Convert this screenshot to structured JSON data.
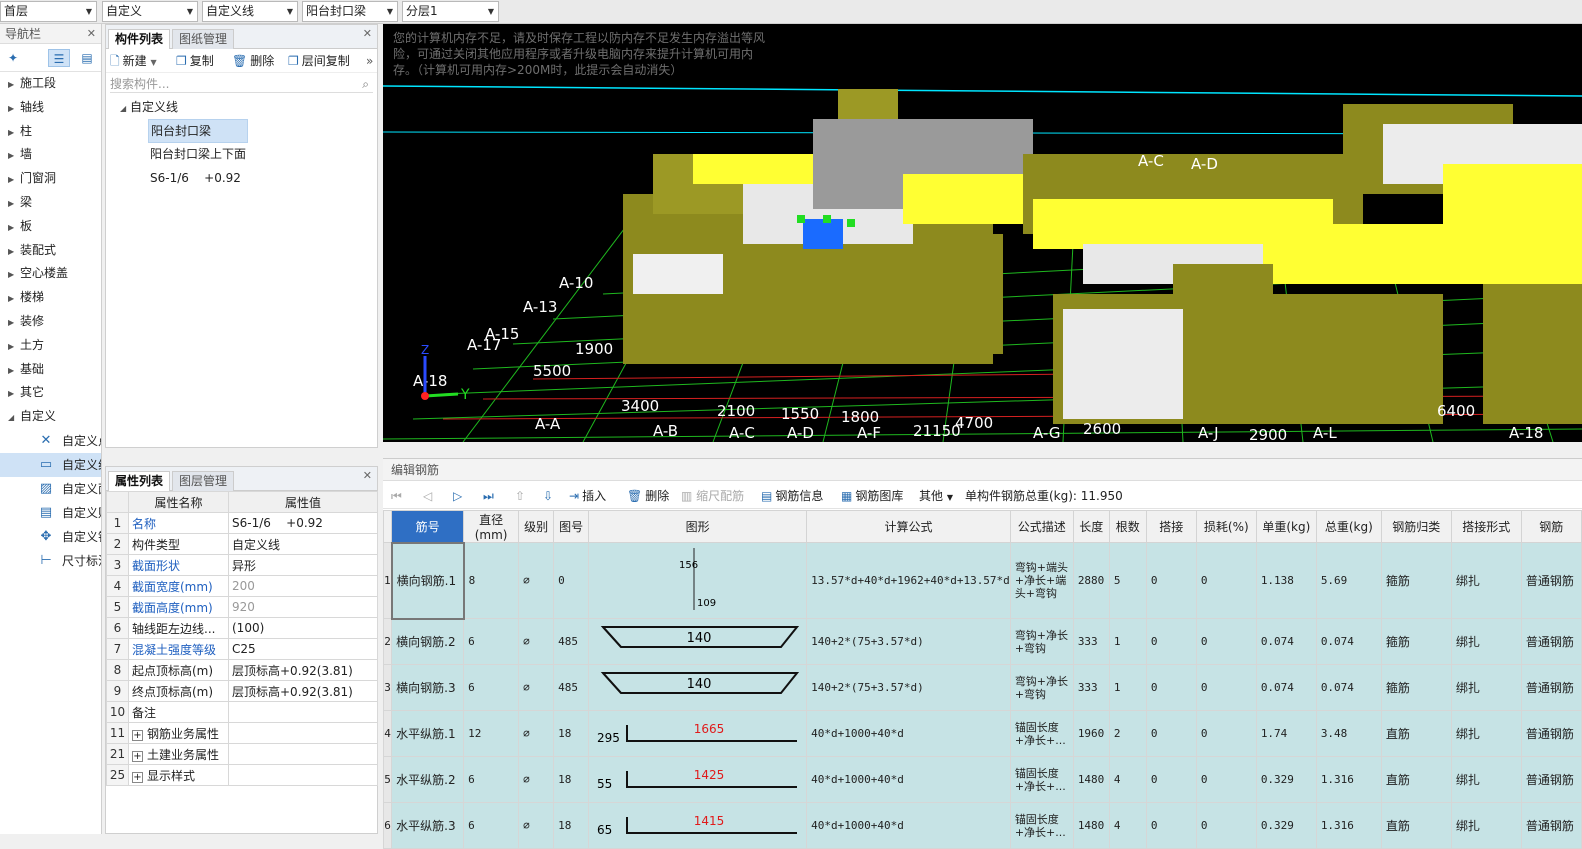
{
  "topbar": {
    "floor": "首层",
    "category": "自定义",
    "type": "自定义线",
    "component": "阳台封口梁",
    "layer": "分层1"
  },
  "nav": {
    "title": "导航栏",
    "items": [
      "施工段",
      "轴线",
      "柱",
      "墙",
      "门窗洞",
      "梁",
      "板",
      "装配式",
      "空心楼盖",
      "楼梯",
      "装修",
      "土方",
      "基础",
      "其它",
      "自定义"
    ],
    "subitems": [
      "自定义点",
      "自定义线",
      "自定义面",
      "自定义贴面",
      "自定义钢筋",
      "尺寸标注"
    ]
  },
  "complist": {
    "tab_active": "构件列表",
    "tab_other": "图纸管理",
    "tools": {
      "new": "新建",
      "copy": "复制",
      "delete": "删除",
      "floor_copy": "层间复制"
    },
    "search_placeholder": "搜索构件...",
    "tree_root": "自定义线",
    "items": [
      "阳台封口梁",
      "阳台封口梁上下面",
      "S6-1/6    +0.92"
    ]
  },
  "props": {
    "tab_active": "属性列表",
    "tab_other": "图层管理",
    "col_name": "属性名称",
    "col_value": "属性值",
    "rows": [
      {
        "n": "1",
        "k": "名称",
        "v": "S6-1/6    +0.92",
        "kc": "blue",
        "vc": ""
      },
      {
        "n": "2",
        "k": "构件类型",
        "v": "自定义线",
        "kc": "",
        "vc": ""
      },
      {
        "n": "3",
        "k": "截面形状",
        "v": "异形",
        "kc": "blue",
        "vc": ""
      },
      {
        "n": "4",
        "k": "截面宽度(mm)",
        "v": "200",
        "kc": "blue",
        "vc": "grey"
      },
      {
        "n": "5",
        "k": "截面高度(mm)",
        "v": "920",
        "kc": "blue",
        "vc": "grey"
      },
      {
        "n": "6",
        "k": "轴线距左边线...",
        "v": "(100)",
        "kc": "",
        "vc": ""
      },
      {
        "n": "7",
        "k": "混凝土强度等级",
        "v": "C25",
        "kc": "blue",
        "vc": ""
      },
      {
        "n": "8",
        "k": "起点顶标高(m)",
        "v": "层顶标高+0.92(3.81)",
        "kc": "",
        "vc": ""
      },
      {
        "n": "9",
        "k": "终点顶标高(m)",
        "v": "层顶标高+0.92(3.81)",
        "kc": "",
        "vc": ""
      },
      {
        "n": "10",
        "k": "备注",
        "v": "",
        "kc": "",
        "vc": ""
      },
      {
        "n": "11",
        "k": "钢筋业务属性",
        "v": "",
        "kc": "",
        "vc": "",
        "g": true
      },
      {
        "n": "21",
        "k": "土建业务属性",
        "v": "",
        "kc": "",
        "vc": "",
        "g": true
      },
      {
        "n": "25",
        "k": "显示样式",
        "v": "",
        "kc": "",
        "vc": "",
        "g": true
      }
    ]
  },
  "viewport": {
    "warning": "您的计算机内存不足，请及时保存工程以防内存不足发生内存溢出等风险，可通过关闭其他应用程序或者升级电脑内存来提升计算机可用内存。（计算机可用内存>200M时，此提示会自动消失）",
    "axis_labels": [
      "A-C",
      "A-D",
      "A-10",
      "A-13",
      "A-15",
      "A-17",
      "A-18",
      "A-A",
      "A-B",
      "A-C",
      "A-D",
      "A-F",
      "A-G",
      "A-J",
      "A-L",
      "A-18"
    ],
    "dims": [
      "3400",
      "2100",
      "1550",
      "1800",
      "21150",
      "4700",
      "2600",
      "2900",
      "6400",
      "5500",
      "1900"
    ],
    "axes": {
      "y": "Y",
      "z": "Z"
    }
  },
  "rebar": {
    "title": "编辑钢筋",
    "tools": {
      "insert": "插入",
      "delete": "删除",
      "scale": "缩尺配筋",
      "info": "钢筋信息",
      "library": "钢筋图库",
      "other": "其他"
    },
    "total": "单构件钢筋总重(kg): 11.950",
    "headers": [
      "筋号",
      "直径(mm)",
      "级别",
      "图号",
      "图形",
      "计算公式",
      "公式描述",
      "长度",
      "根数",
      "搭接",
      "损耗(%)",
      "单重(kg)",
      "总重(kg)",
      "钢筋归类",
      "搭接形式",
      "钢筋"
    ],
    "rows": [
      {
        "n": "1",
        "name": "横向钢筋.1",
        "d": "8",
        "grade": "⌀",
        "fig": "0",
        "formula": "13.57*d+40*d+1962+40*d+13.57*d",
        "desc": "弯钩+端头+净长+端头+弯钩",
        "len": "2880",
        "count": "5",
        "lap": "0",
        "loss": "0",
        "unit": "1.138",
        "total": "5.69",
        "cat": "箍筋",
        "lapform": "绑扎",
        "type": "普通钢筋",
        "shape": "v",
        "s1": "156",
        "s2": "109"
      },
      {
        "n": "2",
        "name": "横向钢筋.2",
        "d": "6",
        "grade": "⌀",
        "fig": "485",
        "formula": "140+2*(75+3.57*d)",
        "desc": "弯钩+净长+弯钩",
        "len": "333",
        "count": "1",
        "lap": "0",
        "loss": "0",
        "unit": "0.074",
        "total": "0.074",
        "cat": "箍筋",
        "lapform": "绑扎",
        "type": "普通钢筋",
        "shape": "t",
        "s1": "140",
        "s2": ""
      },
      {
        "n": "3",
        "name": "横向钢筋.3",
        "d": "6",
        "grade": "⌀",
        "fig": "485",
        "formula": "140+2*(75+3.57*d)",
        "desc": "弯钩+净长+弯钩",
        "len": "333",
        "count": "1",
        "lap": "0",
        "loss": "0",
        "unit": "0.074",
        "total": "0.074",
        "cat": "箍筋",
        "lapform": "绑扎",
        "type": "普通钢筋",
        "shape": "t",
        "s1": "140",
        "s2": ""
      },
      {
        "n": "4",
        "name": "水平纵筋.1",
        "d": "12",
        "grade": "⌀",
        "fig": "18",
        "formula": "40*d+1000+40*d",
        "desc": "锚固长度+净长+...",
        "len": "1960",
        "count": "2",
        "lap": "0",
        "loss": "0",
        "unit": "1.74",
        "total": "3.48",
        "cat": "直筋",
        "lapform": "绑扎",
        "type": "普通钢筋",
        "shape": "l",
        "s1": "295",
        "s2": "1665"
      },
      {
        "n": "5",
        "name": "水平纵筋.2",
        "d": "6",
        "grade": "⌀",
        "fig": "18",
        "formula": "40*d+1000+40*d",
        "desc": "锚固长度+净长+...",
        "len": "1480",
        "count": "4",
        "lap": "0",
        "loss": "0",
        "unit": "0.329",
        "total": "1.316",
        "cat": "直筋",
        "lapform": "绑扎",
        "type": "普通钢筋",
        "shape": "l",
        "s1": "55",
        "s2": "1425"
      },
      {
        "n": "6",
        "name": "水平纵筋.3",
        "d": "6",
        "grade": "⌀",
        "fig": "18",
        "formula": "40*d+1000+40*d",
        "desc": "锚固长度+净长+...",
        "len": "1480",
        "count": "4",
        "lap": "0",
        "loss": "0",
        "unit": "0.329",
        "total": "1.316",
        "cat": "直筋",
        "lapform": "绑扎",
        "type": "普通钢筋",
        "shape": "l",
        "s1": "65",
        "s2": "1415"
      }
    ]
  }
}
